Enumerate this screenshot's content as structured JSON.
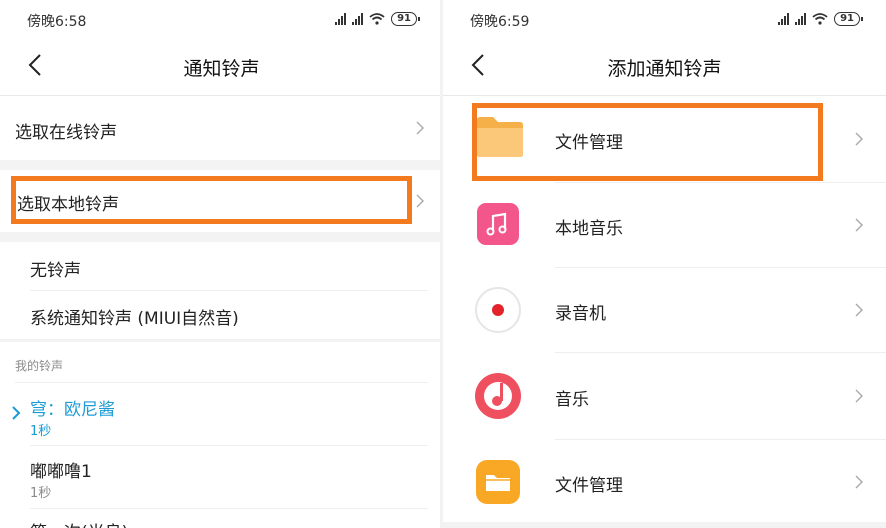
{
  "left": {
    "status_time": "傍晚6:58",
    "battery": "91",
    "title": "通知铃声",
    "online_label": "选取在线铃声",
    "local_label": "选取本地铃声",
    "none_label": "无铃声",
    "system_label": "系统通知铃声 (MIUI自然音)",
    "section_label": "我的铃声",
    "tones": [
      {
        "name": "穹：欧尼酱",
        "duration": "1秒",
        "selected": true
      },
      {
        "name": "嘟嘟噜1",
        "duration": "1秒",
        "selected": false
      },
      {
        "name": "第一次(光良)",
        "duration": "",
        "selected": false
      }
    ]
  },
  "right": {
    "status_time": "傍晚6:59",
    "battery": "91",
    "title": "添加通知铃声",
    "items": [
      {
        "label": "文件管理",
        "icon": "folder-icon"
      },
      {
        "label": "本地音乐",
        "icon": "music-note-icon"
      },
      {
        "label": "录音机",
        "icon": "recorder-icon"
      },
      {
        "label": "音乐",
        "icon": "music-disc-icon"
      },
      {
        "label": "文件管理",
        "icon": "file-manager-icon"
      }
    ]
  },
  "colors": {
    "highlight": "#f47a20",
    "selected_text": "#1a9bd6",
    "folder": "#f9c46a",
    "local_music": "#f2568a",
    "recorder_dot": "#e3232b",
    "music_disc": "#ef5060",
    "file_manager": "#f9a825"
  }
}
